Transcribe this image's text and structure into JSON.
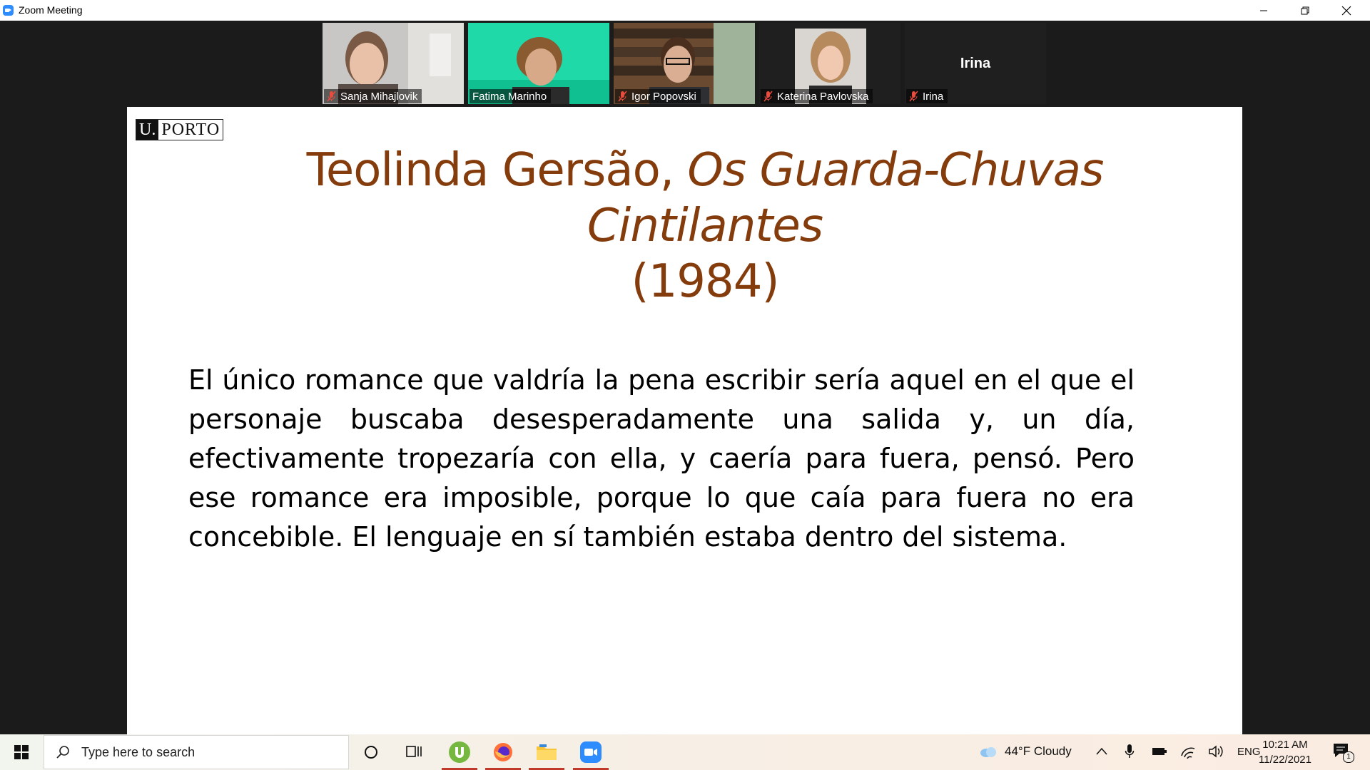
{
  "window": {
    "title": "Zoom Meeting"
  },
  "participants": [
    {
      "name": "Sanja Mihajlovik",
      "muted": true,
      "video": true
    },
    {
      "name": "Fatima Marinho",
      "muted": false,
      "video": true,
      "speaking": true
    },
    {
      "name": "Igor Popovski",
      "muted": true,
      "video": true
    },
    {
      "name": "Katerina Pavlovska",
      "muted": true,
      "video": true
    },
    {
      "name": "Irina",
      "muted": true,
      "video": false
    }
  ],
  "slide": {
    "logo_left": "U.",
    "logo_right": "PORTO",
    "title_author": "Teolinda Gersão, ",
    "title_work": "Os Guarda-Chuvas Cintilantes",
    "title_year": "(1984)",
    "quote": "El único romance que valdría la pena escribir sería aquel en el que el personaje buscaba desesperadamente una salida y, un día, efectivamente tropezaría con ella, y caería para fuera, pensó. Pero ese romance era imposible, porque lo que caía para fuera no era concebible. El lenguaje en sí también estaba dentro del sistema."
  },
  "taskbar": {
    "search_placeholder": "Type here to search",
    "weather": "44°F  Cloudy",
    "language": "ENG",
    "time": "10:21 AM",
    "date": "11/22/2021",
    "notification_count": "1"
  },
  "colors": {
    "title_brown": "#843c0c",
    "speaking_border": "#4cd964",
    "zoom_blue": "#2d8cff"
  }
}
